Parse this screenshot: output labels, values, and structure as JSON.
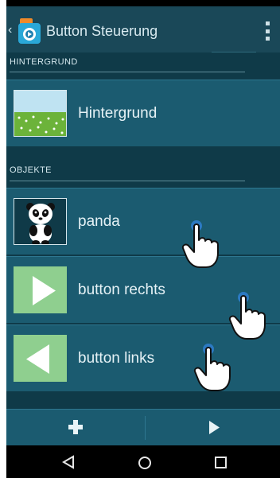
{
  "actionbar": {
    "title": "Button Steuerung"
  },
  "sections": {
    "background": "HINTERGRUND",
    "objects": "OBJEKTE"
  },
  "background_item": {
    "label": "Hintergrund"
  },
  "objects": [
    {
      "label": "panda"
    },
    {
      "label": "button rechts"
    },
    {
      "label": "button links"
    }
  ],
  "icons": {
    "back": "chevron-left-icon",
    "overflow": "overflow-menu-icon",
    "add": "plus-icon",
    "play": "play-icon",
    "nav_back": "nav-back-icon",
    "nav_home": "nav-home-icon",
    "nav_recent": "nav-recent-icon",
    "touch": "touch-hand-icon"
  },
  "colors": {
    "background": "#0f3a48",
    "actionbar": "#1a4858",
    "row": "#1b5b70",
    "accent": "#2e7790"
  }
}
